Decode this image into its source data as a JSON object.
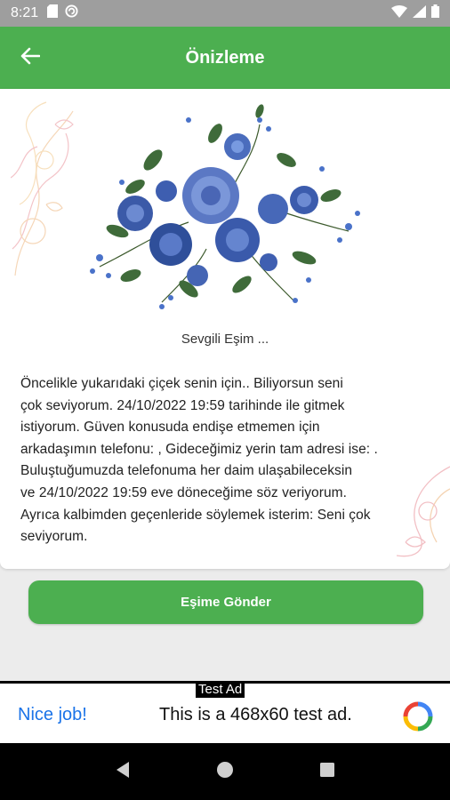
{
  "status_bar": {
    "time": "8:21",
    "left_icons": [
      "sd-card-icon",
      "sync-icon"
    ],
    "right_icons": [
      "wifi-icon",
      "signal-icon",
      "battery-icon"
    ]
  },
  "app_bar": {
    "title": "Önizleme",
    "back_icon": "arrow-back-icon"
  },
  "card": {
    "greeting": "Sevgili Eşim ...",
    "message": "Öncelikle yukarıdaki çiçek senin için.. Biliyorsun seni\nçok seviyorum. 24/10/2022 19:59 tarihinde  ile   gitmek\nistiyorum. Güven konusuda endişe etmemen için\narkadaşımın telefonu: , Gideceğimiz yerin tam adresi ise: .\nBuluştuğumuzda telefonuma her daim ulaşabileceksin\nve  24/10/2022 19:59 eve döneceğime söz veriyorum.\nAyrıca kalbimden geçenleride söylemek isterim: Seni çok\nseviyorum."
  },
  "send_button": {
    "label": "Eşime Gönder"
  },
  "ad": {
    "tag": "Test Ad",
    "nice_text": "Nice job!",
    "body_text": "This is a 468x60 test ad."
  },
  "nav_bar": {
    "icons": [
      "back-triangle-icon",
      "home-circle-icon",
      "recents-square-icon"
    ]
  },
  "colors": {
    "primary": "#4caf50",
    "status_bar": "#9e9e9e",
    "ad_link": "#1a73e8"
  }
}
